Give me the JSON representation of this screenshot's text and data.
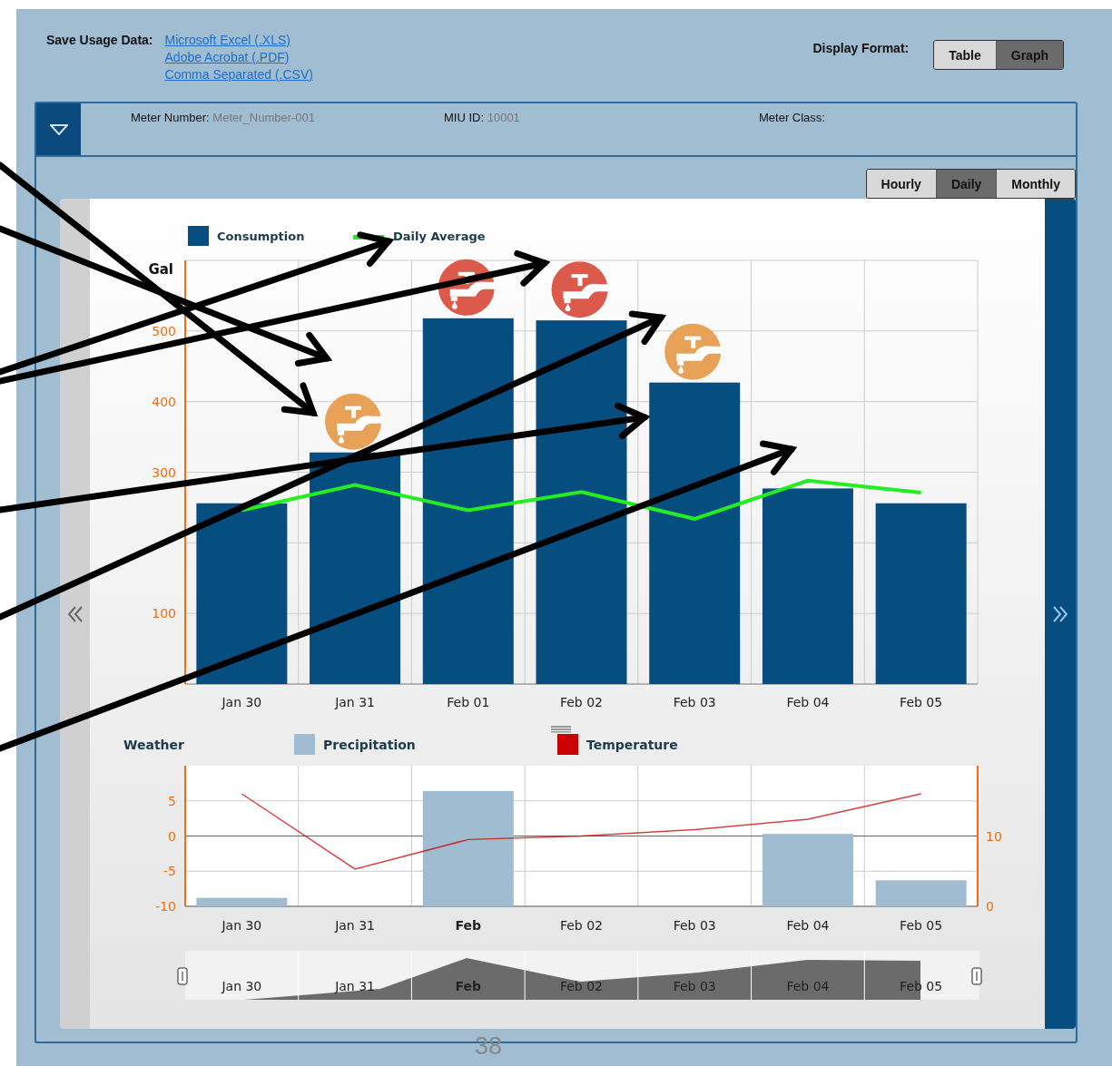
{
  "save_usage": {
    "label": "Save Usage Data:",
    "links": [
      "Microsoft Excel (.XLS)",
      "Adobe Acrobat (.PDF)",
      "Comma Separated (.CSV)"
    ]
  },
  "display_format": {
    "label": "Display Format:",
    "options": [
      {
        "label": "Table",
        "selected": false
      },
      {
        "label": "Graph",
        "selected": true
      }
    ]
  },
  "meter_fields": [
    {
      "label": "Meter Number:",
      "value": "Meter_Number-001"
    },
    {
      "label": "MIU ID:",
      "value": "10001"
    },
    {
      "label": "Meter Class:"
    }
  ],
  "periods": [
    {
      "label": "Hourly",
      "selected": false
    },
    {
      "label": "Daily",
      "selected": true
    },
    {
      "label": "Monthly",
      "selected": false
    }
  ],
  "consumption_chart": {
    "chart_data": {
      "type": "bar",
      "ylabel": "Gal",
      "categories": [
        "Jan 30",
        "Jan 31",
        "Feb 01",
        "Feb 02",
        "Feb 03",
        "Feb 04",
        "Feb 05"
      ],
      "ylim": [
        0,
        600
      ],
      "yticks": [
        100,
        300,
        400,
        500
      ],
      "grid": true,
      "legend": "top",
      "series": [
        {
          "name": "Consumption",
          "type": "bar",
          "color": "#064d80",
          "values": [
            256,
            328,
            518,
            515,
            427,
            277,
            256
          ]
        },
        {
          "name": "Daily Average",
          "type": "line",
          "color": "#22ee22",
          "values": [
            246,
            282,
            246,
            272,
            234,
            288,
            271
          ]
        }
      ]
    },
    "alerts": [
      {
        "kind": "none"
      },
      {
        "kind": "faucet",
        "color": "#e8a258"
      },
      {
        "kind": "faucet",
        "color": "#dc5a4c"
      },
      {
        "kind": "faucet",
        "color": "#dc5a4c"
      },
      {
        "kind": "faucet",
        "color": "#e8a258"
      },
      {
        "kind": "none"
      },
      {
        "kind": "none"
      }
    ]
  },
  "weather_chart": {
    "title": "Weather",
    "chart_data": {
      "type": "bar",
      "categories": [
        "Jan 30",
        "Jan 31",
        "Feb",
        "Feb 02",
        "Feb 03",
        "Feb 04",
        "Feb 05"
      ],
      "ylim": [
        -10,
        10
      ],
      "yticks": [
        -10,
        -5,
        0,
        5
      ],
      "y2lim": [
        0,
        20
      ],
      "y2ticks": [
        0,
        10
      ],
      "grid": true,
      "legend": "top",
      "series": [
        {
          "name": "Precipitation",
          "type": "bar",
          "axis": "y2",
          "color": "#a0bcd0",
          "values": [
            1.2,
            0,
            16.4,
            0,
            0,
            10.3,
            3.7
          ]
        },
        {
          "name": "Temperature",
          "type": "line",
          "color": "#cc0000",
          "values": [
            6,
            -4.7,
            -0.5,
            0,
            0.9,
            2.4,
            6
          ]
        }
      ]
    }
  },
  "navigator": {
    "labels": [
      "Jan 30",
      "Jan 31",
      "Feb",
      "Feb 02",
      "Feb 03",
      "Feb 04",
      "Feb 05"
    ]
  },
  "page_number": "38"
}
